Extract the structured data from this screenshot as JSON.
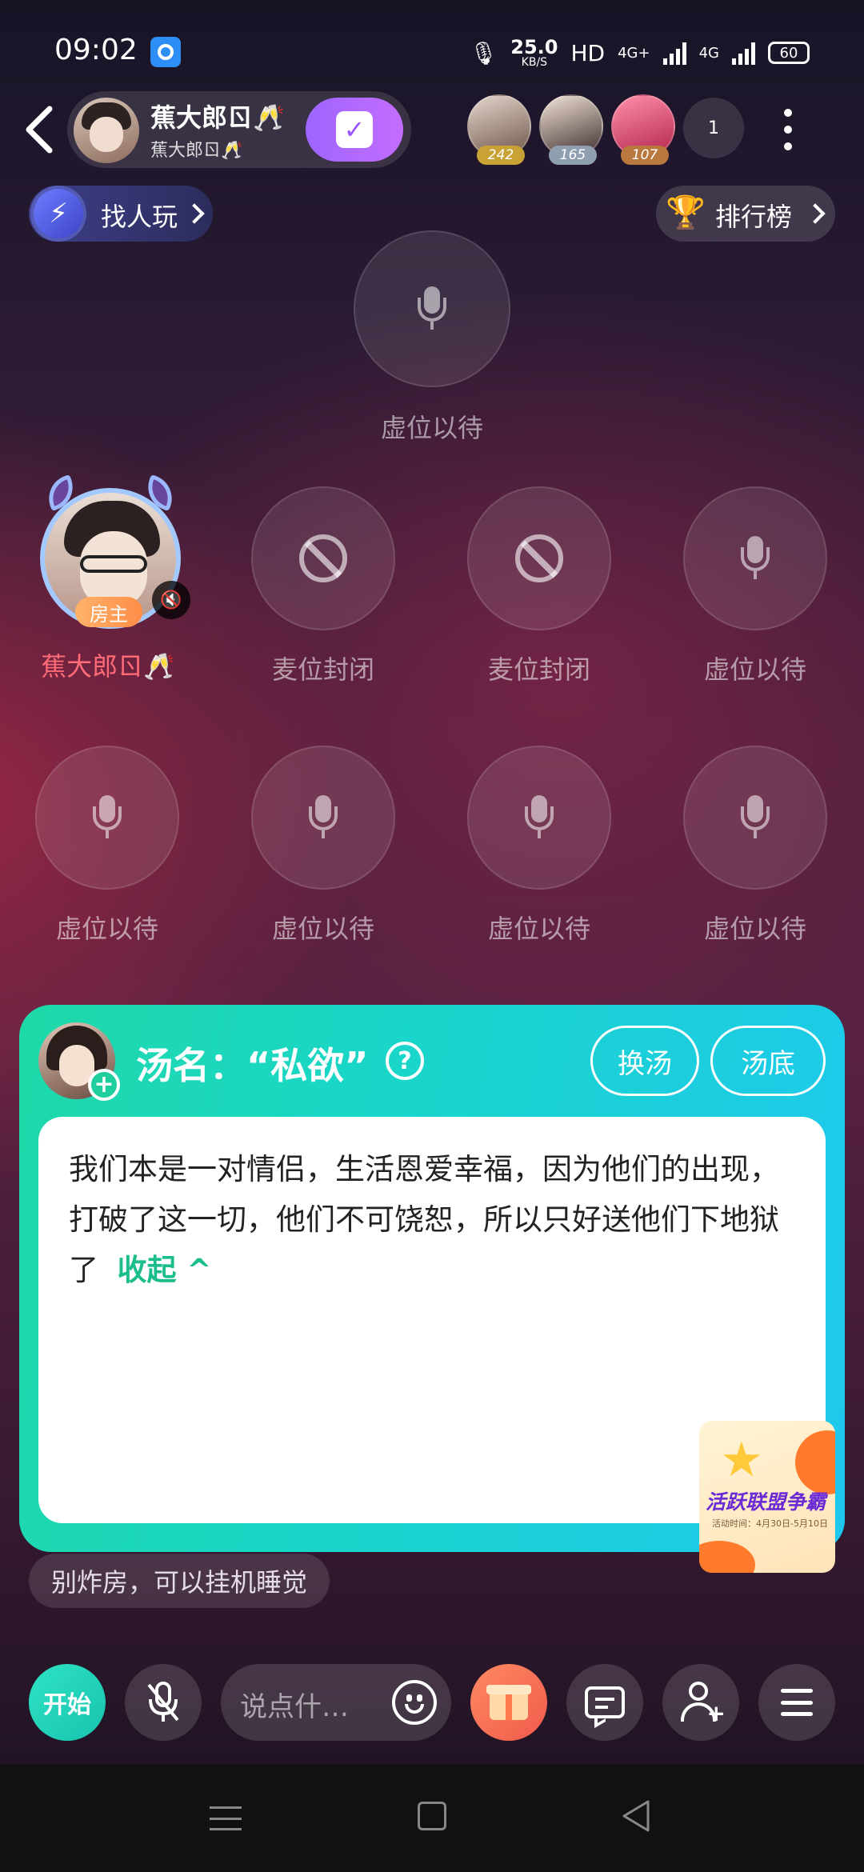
{
  "status_bar": {
    "time": "09:02",
    "net_speed_value": "25.0",
    "net_speed_unit": "KB/S",
    "hd": "HD",
    "net1": "4G+",
    "net2": "4G",
    "battery": "60"
  },
  "header": {
    "host_name": "蕉大郎ㄖ🥂",
    "host_subname": "蕉大郎ㄖ🥂",
    "audience": [
      {
        "count": "242",
        "badge_color": "#c9a236"
      },
      {
        "count": "165",
        "badge_color": "#8f9fb0"
      },
      {
        "count": "107",
        "badge_color": "#b9783e"
      }
    ],
    "audience_count": "1"
  },
  "pills": {
    "find_player": "找人玩",
    "ranking": "排行榜"
  },
  "seats": {
    "top_seat_label": "虚位以待",
    "host_seat_name": "蕉大郎ㄖ🥂",
    "host_badge": "房主",
    "row1": [
      {
        "label": "麦位封闭",
        "state": "closed"
      },
      {
        "label": "麦位封闭",
        "state": "closed"
      },
      {
        "label": "虚位以待",
        "state": "empty"
      }
    ],
    "row2": [
      {
        "label": "虚位以待",
        "state": "empty"
      },
      {
        "label": "虚位以待",
        "state": "empty"
      },
      {
        "label": "虚位以待",
        "state": "empty"
      },
      {
        "label": "虚位以待",
        "state": "empty"
      }
    ]
  },
  "soup_panel": {
    "title": "汤名：“私欲”",
    "help_icon": "?",
    "change_soup": "换汤",
    "soup_answer": "汤底",
    "story": "我们本是一对情侣，生活恩爱幸福，因为他们的出现，打破了这一切，他们不可饶恕，所以只好送他们下地狱了",
    "collapse": "收起 ^",
    "event_title": "活跃联盟争霸",
    "event_date": "活动时间：4月30日-5月10日"
  },
  "chat_hint": "别炸房，可以挂机睡觉",
  "toolbar": {
    "start": "开始",
    "chat_placeholder": "说点什…"
  },
  "colors": {
    "accent_teal": "#1fd9a8",
    "accent_cyan": "#1ec8ee",
    "host_name_red": "#ff6b77",
    "checkin_purple": "#9d65ff"
  }
}
